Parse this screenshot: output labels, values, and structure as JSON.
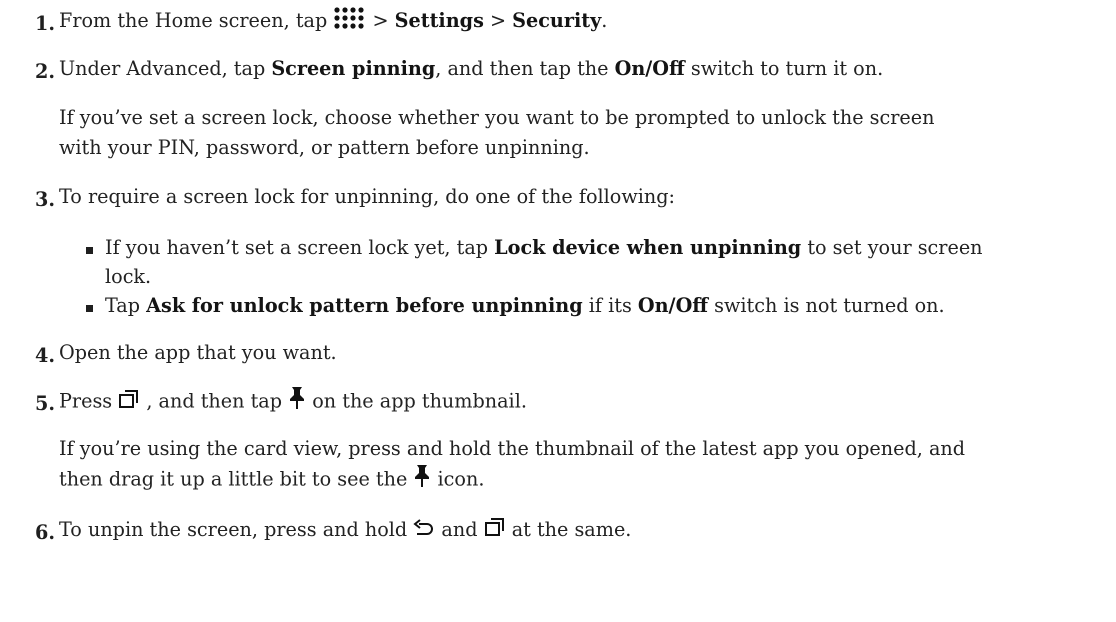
{
  "steps": [
    {
      "number": "1.",
      "parts": {
        "a": "From the Home screen, tap ",
        "icon": "apps-grid-icon",
        "b": " > ",
        "settings": "Settings",
        "c": " > ",
        "security": "Security",
        "d": "."
      }
    },
    {
      "number": "2.",
      "parts": {
        "a": "Under Advanced, tap ",
        "screen_pinning": "Screen pinning",
        "b": ", and then tap the ",
        "on_off": "On/Off",
        "c": " switch to turn it on."
      },
      "note_lines": [
        "If you’ve set a screen lock, choose whether you want to be prompted to unlock the screen",
        "with your PIN, password, or pattern before unpinning."
      ]
    },
    {
      "number": "3.",
      "text": "To require a screen lock for unpinning, do one of the following:",
      "bullets": [
        {
          "a": "If you haven’t set a screen lock yet, tap ",
          "bold": "Lock device when unpinning",
          "b": " to set your screen",
          "cont": "lock."
        },
        {
          "a": "Tap ",
          "bold": "Ask for unlock pattern before unpinning",
          "b": " if its ",
          "bold2": "On/Off",
          "c": " switch is not turned on."
        }
      ]
    },
    {
      "number": "4.",
      "text": "Open the app that you want."
    },
    {
      "number": "5.",
      "parts": {
        "a": "Press ",
        "icon1": "recent-apps-icon",
        "b": " , and then tap ",
        "icon2": "pin-icon",
        "c": " on the app thumbnail."
      },
      "note": {
        "line1": "If you’re using the card view, press and hold the thumbnail of the latest app you opened, and",
        "line2a": "then drag it up a little bit to see the ",
        "icon": "pin-icon",
        "line2b": " icon."
      }
    },
    {
      "number": "6.",
      "parts": {
        "a": "To unpin the screen, press and hold ",
        "icon1": "back-icon",
        "b": " and ",
        "icon2": "recent-apps-icon",
        "c": " at the same."
      }
    }
  ]
}
